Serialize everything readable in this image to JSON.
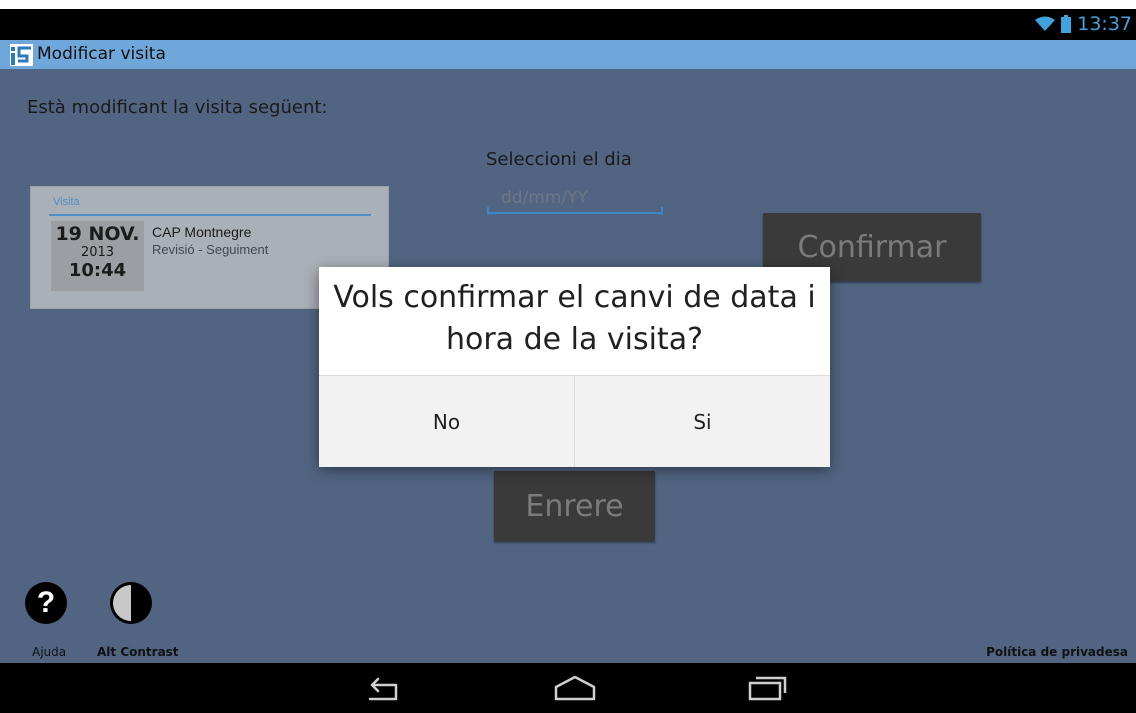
{
  "status": {
    "time": "13:37"
  },
  "app": {
    "title": "Modificar visita"
  },
  "intro": "Està modificant la visita següent:",
  "visit": {
    "label": "Visita",
    "day": "19 NOV.",
    "year": "2013",
    "time": "10:44",
    "place": "CAP Montnegre",
    "type": "Revisió - Seguiment"
  },
  "select": {
    "label": "Seleccioni el dia",
    "placeholder": "dd/mm/YY"
  },
  "buttons": {
    "confirm": "Confirmar",
    "back": "Enrere"
  },
  "dialog": {
    "message": "Vols confirmar el canvi de data i hora de la visita?",
    "no": "No",
    "yes": "Si"
  },
  "footer": {
    "help": "Ajuda",
    "contrast": "Alt Contrast",
    "privacy": "Política de privadesa"
  },
  "colors": {
    "titlebar": "#6fa7da",
    "background": "#516582",
    "accent": "#3d86c6"
  },
  "icons": [
    "wifi-icon",
    "battery-icon",
    "help-icon",
    "contrast-icon",
    "back-icon",
    "home-icon",
    "recents-icon"
  ]
}
